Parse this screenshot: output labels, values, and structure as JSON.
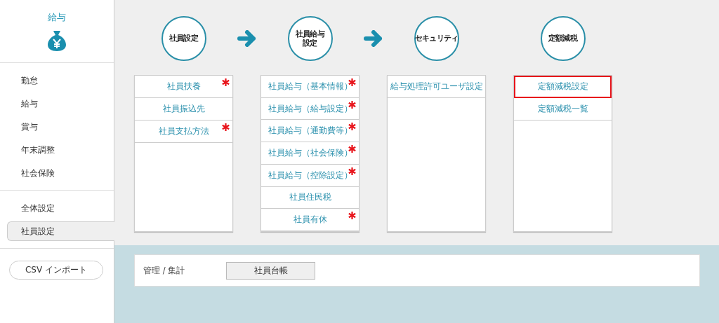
{
  "sidebar": {
    "title": "給与",
    "groups": [
      {
        "items": [
          {
            "label": "勤怠",
            "selected": false
          },
          {
            "label": "給与",
            "selected": false
          },
          {
            "label": "賞与",
            "selected": false
          },
          {
            "label": "年末調整",
            "selected": false
          },
          {
            "label": "社会保険",
            "selected": false
          }
        ]
      },
      {
        "items": [
          {
            "label": "全体設定",
            "selected": false
          },
          {
            "label": "社員設定",
            "selected": true
          }
        ]
      }
    ],
    "import_button": "CSV インポート"
  },
  "steps": [
    {
      "title_lines": [
        "社員設定"
      ],
      "arrow_after": true,
      "items": [
        {
          "label": "社員扶養",
          "required": true,
          "selected": false
        },
        {
          "label": "社員振込先",
          "required": false,
          "selected": false
        },
        {
          "label": "社員支払方法",
          "required": true,
          "selected": false
        }
      ]
    },
    {
      "title_lines": [
        "社員給与",
        "設定"
      ],
      "arrow_after": true,
      "items": [
        {
          "label": "社員給与（基本情報）",
          "required": true,
          "selected": false
        },
        {
          "label": "社員給与（給与設定）",
          "required": true,
          "selected": false
        },
        {
          "label": "社員給与（通勤費等）",
          "required": true,
          "selected": false
        },
        {
          "label": "社員給与（社会保険）",
          "required": true,
          "selected": false
        },
        {
          "label": "社員給与（控除設定）",
          "required": true,
          "selected": false
        },
        {
          "label": "社員住民税",
          "required": false,
          "selected": false
        },
        {
          "label": "社員有休",
          "required": true,
          "selected": false
        }
      ]
    },
    {
      "title_lines": [
        "セキュリティ"
      ],
      "items": [
        {
          "label": "給与処理許可ユーザ設定",
          "required": false,
          "selected": false
        }
      ]
    },
    {
      "title_lines": [
        "定額減税"
      ],
      "items": [
        {
          "label": "定額減税設定",
          "required": false,
          "selected": true
        },
        {
          "label": "定額減税一覧",
          "required": false,
          "selected": false
        }
      ]
    }
  ],
  "management": {
    "label": "管理 / 集計",
    "buttons": [
      "社員台帳"
    ]
  }
}
